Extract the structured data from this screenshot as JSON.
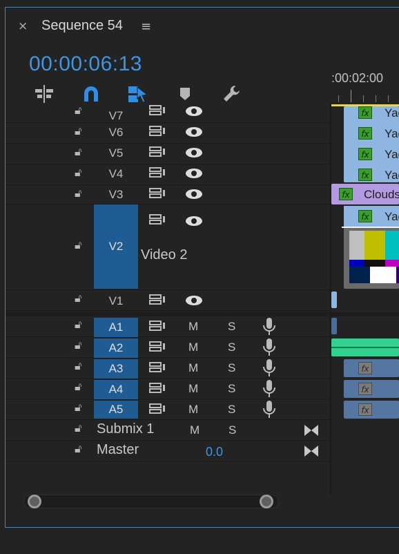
{
  "panel": {
    "close_icon": "×",
    "title": "Sequence 54",
    "menu_icon": "≡",
    "timecode": "00:00:06:13",
    "ruler_label": ":00:02:00"
  },
  "tools": [
    "insert-tool-icon",
    "snap-magnet-icon",
    "linked-selection-icon",
    "add-marker-icon",
    "wrench-settings-icon"
  ],
  "video_tracks": [
    {
      "name": "V7"
    },
    {
      "name": "V6"
    },
    {
      "name": "V5"
    },
    {
      "name": "V4"
    },
    {
      "name": "V3"
    },
    {
      "name": "V2",
      "expanded_name": "Video 2"
    },
    {
      "name": "V1"
    }
  ],
  "audio_tracks": [
    {
      "name": "A1",
      "m": "M",
      "s": "S"
    },
    {
      "name": "A2",
      "m": "M",
      "s": "S"
    },
    {
      "name": "A3",
      "m": "M",
      "s": "S"
    },
    {
      "name": "A4",
      "m": "M",
      "s": "S"
    },
    {
      "name": "A5",
      "m": "M",
      "s": "S"
    }
  ],
  "submix": {
    "name": "Submix 1",
    "m": "M",
    "s": "S"
  },
  "master": {
    "name": "Master",
    "value": "0.0"
  },
  "clips": {
    "yacht_label": "Yac",
    "clouds_label": "Clouds",
    "fx_label": "fx"
  },
  "colors": {
    "accent": "#2d8ceb",
    "timecode": "#3d95e6",
    "track_selected": "#1f5c93",
    "video_clip": "#8fb6e1",
    "clouds_clip": "#b49ae0",
    "audio_clip": "#2fd28f"
  }
}
